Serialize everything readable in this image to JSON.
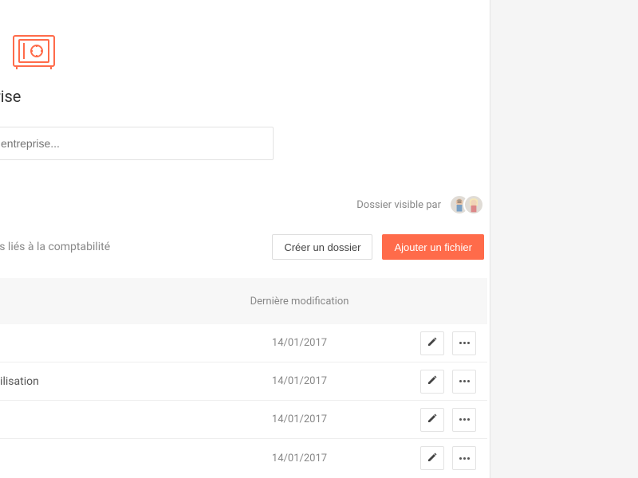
{
  "page": {
    "title_suffix": "rs de l’entreprise"
  },
  "search": {
    "placeholder": "entreprise..."
  },
  "visibility": {
    "label": "Dossier visible par"
  },
  "folder": {
    "description_suffix": "cuments informatifs liés à la comptabilité"
  },
  "actions": {
    "create_folder": "Créer un dossier",
    "add_file": "Ajouter un fichier"
  },
  "table": {
    "header_date": "Dernière modification",
    "rows": [
      {
        "name_suffix": "",
        "date": "14/01/2017"
      },
      {
        "name_suffix": "tabilisation",
        "date": "14/01/2017"
      },
      {
        "name_suffix": "",
        "date": "14/01/2017"
      },
      {
        "name_suffix": "",
        "date": "14/01/2017"
      }
    ]
  }
}
